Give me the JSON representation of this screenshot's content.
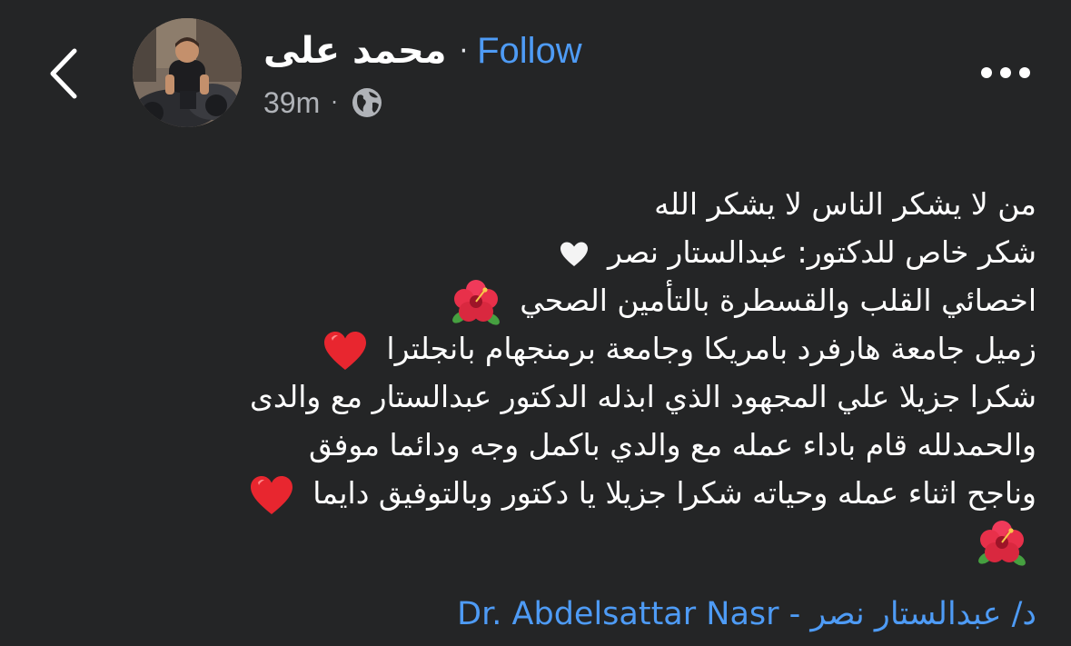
{
  "post": {
    "author_name": "محمد على",
    "separator": "·",
    "follow_label": "Follow",
    "time": "39m",
    "meta_separator": "·",
    "audience_icon": "globe-icon",
    "lines": [
      "من لا يشكر الناس لا يشكر الله",
      "شكر خاص للدكتور: عبدالستار نصر",
      "اخصائي القلب والقسطرة بالتأمين الصحي",
      "زميل جامعة هارفرد بامريكا وجامعة برمنجهام بانجلترا",
      "شكرا جزيلا علي المجهود الذي ابذله الدكتور عبدالستار مع والدى",
      "والحمدلله قام باداء عمله مع والدي باكمل وجه ودائما موفق",
      "وناجح اثناء عمله وحياته شكرا جزيلا يا دكتور وبالتوفيق دايما",
      ""
    ],
    "line_emojis": [
      "",
      "white-heart-icon",
      "hibiscus-icon",
      "red-heart-icon",
      "",
      "",
      "red-heart-icon",
      "hibiscus-icon"
    ],
    "mention": "د/ عبدالستار نصر - Dr. Abdelsattar Nasr"
  },
  "icons": {
    "back": "chevron-left-icon",
    "more": "more-horizontal-icon",
    "avatar": "avatar"
  },
  "colors": {
    "background": "#242526",
    "text": "#ffffff",
    "secondary_text": "#b0b3b8",
    "link": "#4e9bf5",
    "heart_red": "#e8262f",
    "hibiscus": "#e8304a"
  }
}
